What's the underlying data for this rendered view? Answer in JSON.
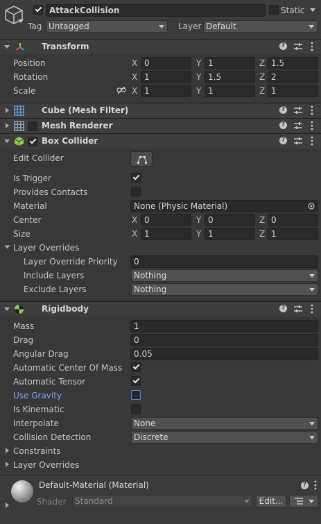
{
  "gameobject": {
    "name": "AttackCollision",
    "static_label": "Static",
    "tag_label": "Tag",
    "tag_value": "Untagged",
    "layer_label": "Layer",
    "layer_value": "Default"
  },
  "transform": {
    "title": "Transform",
    "position": {
      "label": "Position",
      "x": "0",
      "y": "1",
      "z": "1.5"
    },
    "rotation": {
      "label": "Rotation",
      "x": "1",
      "y": "1.5",
      "z": "2"
    },
    "scale": {
      "label": "Scale",
      "x": "1",
      "y": "1",
      "z": "1"
    },
    "axis": {
      "x": "X",
      "y": "Y",
      "z": "Z"
    }
  },
  "mesh_filter": {
    "title": "Cube (Mesh Filter)"
  },
  "mesh_renderer": {
    "title": "Mesh Renderer"
  },
  "box_collider": {
    "title": "Box Collider",
    "edit_collider": "Edit Collider",
    "is_trigger": "Is Trigger",
    "provides_contacts": "Provides Contacts",
    "material_label": "Material",
    "material_value": "None (Physic Material)",
    "center": {
      "label": "Center",
      "x": "0",
      "y": "0",
      "z": "0"
    },
    "size": {
      "label": "Size",
      "x": "1",
      "y": "1",
      "z": "1"
    },
    "layer_overrides": "Layer Overrides",
    "override_priority_label": "Layer Override Priority",
    "override_priority_value": "0",
    "include_label": "Include Layers",
    "include_value": "Nothing",
    "exclude_label": "Exclude Layers",
    "exclude_value": "Nothing"
  },
  "rigidbody": {
    "title": "Rigidbody",
    "mass_label": "Mass",
    "mass_value": "1",
    "drag_label": "Drag",
    "drag_value": "0",
    "angular_drag_label": "Angular Drag",
    "angular_drag_value": "0.05",
    "auto_com_label": "Automatic Center Of Mass",
    "auto_tensor_label": "Automatic Tensor",
    "use_gravity_label": "Use Gravity",
    "is_kinematic_label": "Is Kinematic",
    "interpolate_label": "Interpolate",
    "interpolate_value": "None",
    "collision_label": "Collision Detection",
    "collision_value": "Discrete",
    "constraints_label": "Constraints",
    "layer_overrides_label": "Layer Overrides"
  },
  "material": {
    "title": "Default-Material (Material)",
    "shader_label": "Shader",
    "shader_value": "Standard",
    "edit_button": "Edit..."
  },
  "colors": {
    "background": "#383838",
    "header": "#3e3e3e",
    "link_blue": "#7ba4e8",
    "transform_red": "#e04a4a",
    "collider_green": "#8ed14a"
  }
}
